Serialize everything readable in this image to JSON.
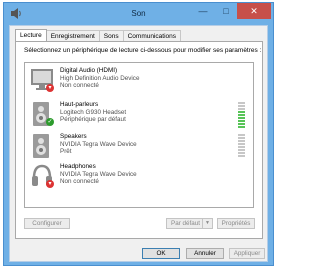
{
  "window": {
    "title": "Son"
  },
  "tabs": [
    {
      "label": "Lecture",
      "active": true
    },
    {
      "label": "Enregistrement",
      "active": false
    },
    {
      "label": "Sons",
      "active": false
    },
    {
      "label": "Communications",
      "active": false
    }
  ],
  "panel": {
    "instruction": "Sélectionnez un périphérique de lecture ci-dessous pour modifier ses paramètres :"
  },
  "devices": [
    {
      "name": "Digital Audio (HDMI)",
      "subtitle": "High Definition Audio Device",
      "status": "Non connecté",
      "icon": "monitor-icon",
      "badge": "disconnected"
    },
    {
      "name": "Haut-parleurs",
      "subtitle": "Logitech G930 Headset",
      "status": "Périphérique par défaut",
      "icon": "speaker-icon",
      "badge": "default",
      "level": 0.6
    },
    {
      "name": "Speakers",
      "subtitle": "NVIDIA Tegra Wave Device",
      "status": "Prêt",
      "icon": "speaker-icon",
      "badge": "none"
    },
    {
      "name": "Headphones",
      "subtitle": "NVIDIA Tegra Wave Device",
      "status": "Non connecté",
      "icon": "headphones-icon",
      "badge": "disconnected"
    }
  ],
  "buttons": {
    "configure": "Configurer",
    "set_default": "Par défaut",
    "properties": "Propriétés",
    "ok": "OK",
    "cancel": "Annuler",
    "apply": "Appliquer"
  },
  "colors": {
    "titlebar": "#6fb0e6",
    "close": "#c7504a",
    "meter_on": "#58c458",
    "badge_red": "#dd3333",
    "badge_green": "#2d9b2d"
  }
}
